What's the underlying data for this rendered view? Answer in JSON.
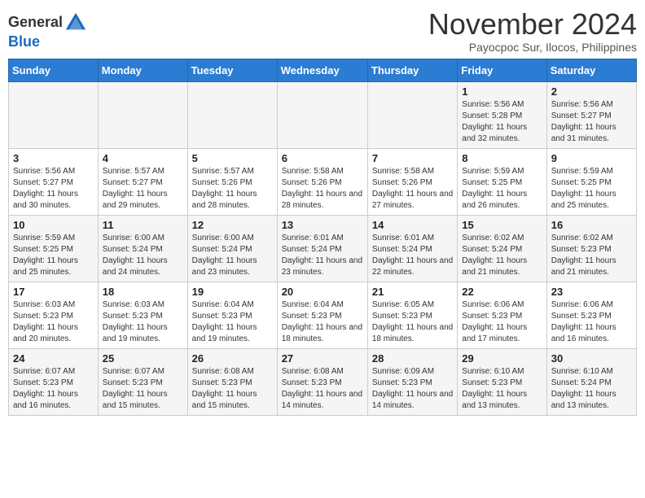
{
  "header": {
    "logo_line1": "General",
    "logo_line2": "Blue",
    "month_year": "November 2024",
    "location": "Payocpoc Sur, Ilocos, Philippines"
  },
  "weekdays": [
    "Sunday",
    "Monday",
    "Tuesday",
    "Wednesday",
    "Thursday",
    "Friday",
    "Saturday"
  ],
  "weeks": [
    [
      {
        "day": "",
        "sunrise": "",
        "sunset": "",
        "daylight": ""
      },
      {
        "day": "",
        "sunrise": "",
        "sunset": "",
        "daylight": ""
      },
      {
        "day": "",
        "sunrise": "",
        "sunset": "",
        "daylight": ""
      },
      {
        "day": "",
        "sunrise": "",
        "sunset": "",
        "daylight": ""
      },
      {
        "day": "",
        "sunrise": "",
        "sunset": "",
        "daylight": ""
      },
      {
        "day": "1",
        "sunrise": "5:56 AM",
        "sunset": "5:28 PM",
        "daylight": "11 hours and 32 minutes."
      },
      {
        "day": "2",
        "sunrise": "5:56 AM",
        "sunset": "5:27 PM",
        "daylight": "11 hours and 31 minutes."
      }
    ],
    [
      {
        "day": "3",
        "sunrise": "5:56 AM",
        "sunset": "5:27 PM",
        "daylight": "11 hours and 30 minutes."
      },
      {
        "day": "4",
        "sunrise": "5:57 AM",
        "sunset": "5:27 PM",
        "daylight": "11 hours and 29 minutes."
      },
      {
        "day": "5",
        "sunrise": "5:57 AM",
        "sunset": "5:26 PM",
        "daylight": "11 hours and 28 minutes."
      },
      {
        "day": "6",
        "sunrise": "5:58 AM",
        "sunset": "5:26 PM",
        "daylight": "11 hours and 28 minutes."
      },
      {
        "day": "7",
        "sunrise": "5:58 AM",
        "sunset": "5:26 PM",
        "daylight": "11 hours and 27 minutes."
      },
      {
        "day": "8",
        "sunrise": "5:59 AM",
        "sunset": "5:25 PM",
        "daylight": "11 hours and 26 minutes."
      },
      {
        "day": "9",
        "sunrise": "5:59 AM",
        "sunset": "5:25 PM",
        "daylight": "11 hours and 25 minutes."
      }
    ],
    [
      {
        "day": "10",
        "sunrise": "5:59 AM",
        "sunset": "5:25 PM",
        "daylight": "11 hours and 25 minutes."
      },
      {
        "day": "11",
        "sunrise": "6:00 AM",
        "sunset": "5:24 PM",
        "daylight": "11 hours and 24 minutes."
      },
      {
        "day": "12",
        "sunrise": "6:00 AM",
        "sunset": "5:24 PM",
        "daylight": "11 hours and 23 minutes."
      },
      {
        "day": "13",
        "sunrise": "6:01 AM",
        "sunset": "5:24 PM",
        "daylight": "11 hours and 23 minutes."
      },
      {
        "day": "14",
        "sunrise": "6:01 AM",
        "sunset": "5:24 PM",
        "daylight": "11 hours and 22 minutes."
      },
      {
        "day": "15",
        "sunrise": "6:02 AM",
        "sunset": "5:24 PM",
        "daylight": "11 hours and 21 minutes."
      },
      {
        "day": "16",
        "sunrise": "6:02 AM",
        "sunset": "5:23 PM",
        "daylight": "11 hours and 21 minutes."
      }
    ],
    [
      {
        "day": "17",
        "sunrise": "6:03 AM",
        "sunset": "5:23 PM",
        "daylight": "11 hours and 20 minutes."
      },
      {
        "day": "18",
        "sunrise": "6:03 AM",
        "sunset": "5:23 PM",
        "daylight": "11 hours and 19 minutes."
      },
      {
        "day": "19",
        "sunrise": "6:04 AM",
        "sunset": "5:23 PM",
        "daylight": "11 hours and 19 minutes."
      },
      {
        "day": "20",
        "sunrise": "6:04 AM",
        "sunset": "5:23 PM",
        "daylight": "11 hours and 18 minutes."
      },
      {
        "day": "21",
        "sunrise": "6:05 AM",
        "sunset": "5:23 PM",
        "daylight": "11 hours and 18 minutes."
      },
      {
        "day": "22",
        "sunrise": "6:06 AM",
        "sunset": "5:23 PM",
        "daylight": "11 hours and 17 minutes."
      },
      {
        "day": "23",
        "sunrise": "6:06 AM",
        "sunset": "5:23 PM",
        "daylight": "11 hours and 16 minutes."
      }
    ],
    [
      {
        "day": "24",
        "sunrise": "6:07 AM",
        "sunset": "5:23 PM",
        "daylight": "11 hours and 16 minutes."
      },
      {
        "day": "25",
        "sunrise": "6:07 AM",
        "sunset": "5:23 PM",
        "daylight": "11 hours and 15 minutes."
      },
      {
        "day": "26",
        "sunrise": "6:08 AM",
        "sunset": "5:23 PM",
        "daylight": "11 hours and 15 minutes."
      },
      {
        "day": "27",
        "sunrise": "6:08 AM",
        "sunset": "5:23 PM",
        "daylight": "11 hours and 14 minutes."
      },
      {
        "day": "28",
        "sunrise": "6:09 AM",
        "sunset": "5:23 PM",
        "daylight": "11 hours and 14 minutes."
      },
      {
        "day": "29",
        "sunrise": "6:10 AM",
        "sunset": "5:23 PM",
        "daylight": "11 hours and 13 minutes."
      },
      {
        "day": "30",
        "sunrise": "6:10 AM",
        "sunset": "5:24 PM",
        "daylight": "11 hours and 13 minutes."
      }
    ]
  ]
}
